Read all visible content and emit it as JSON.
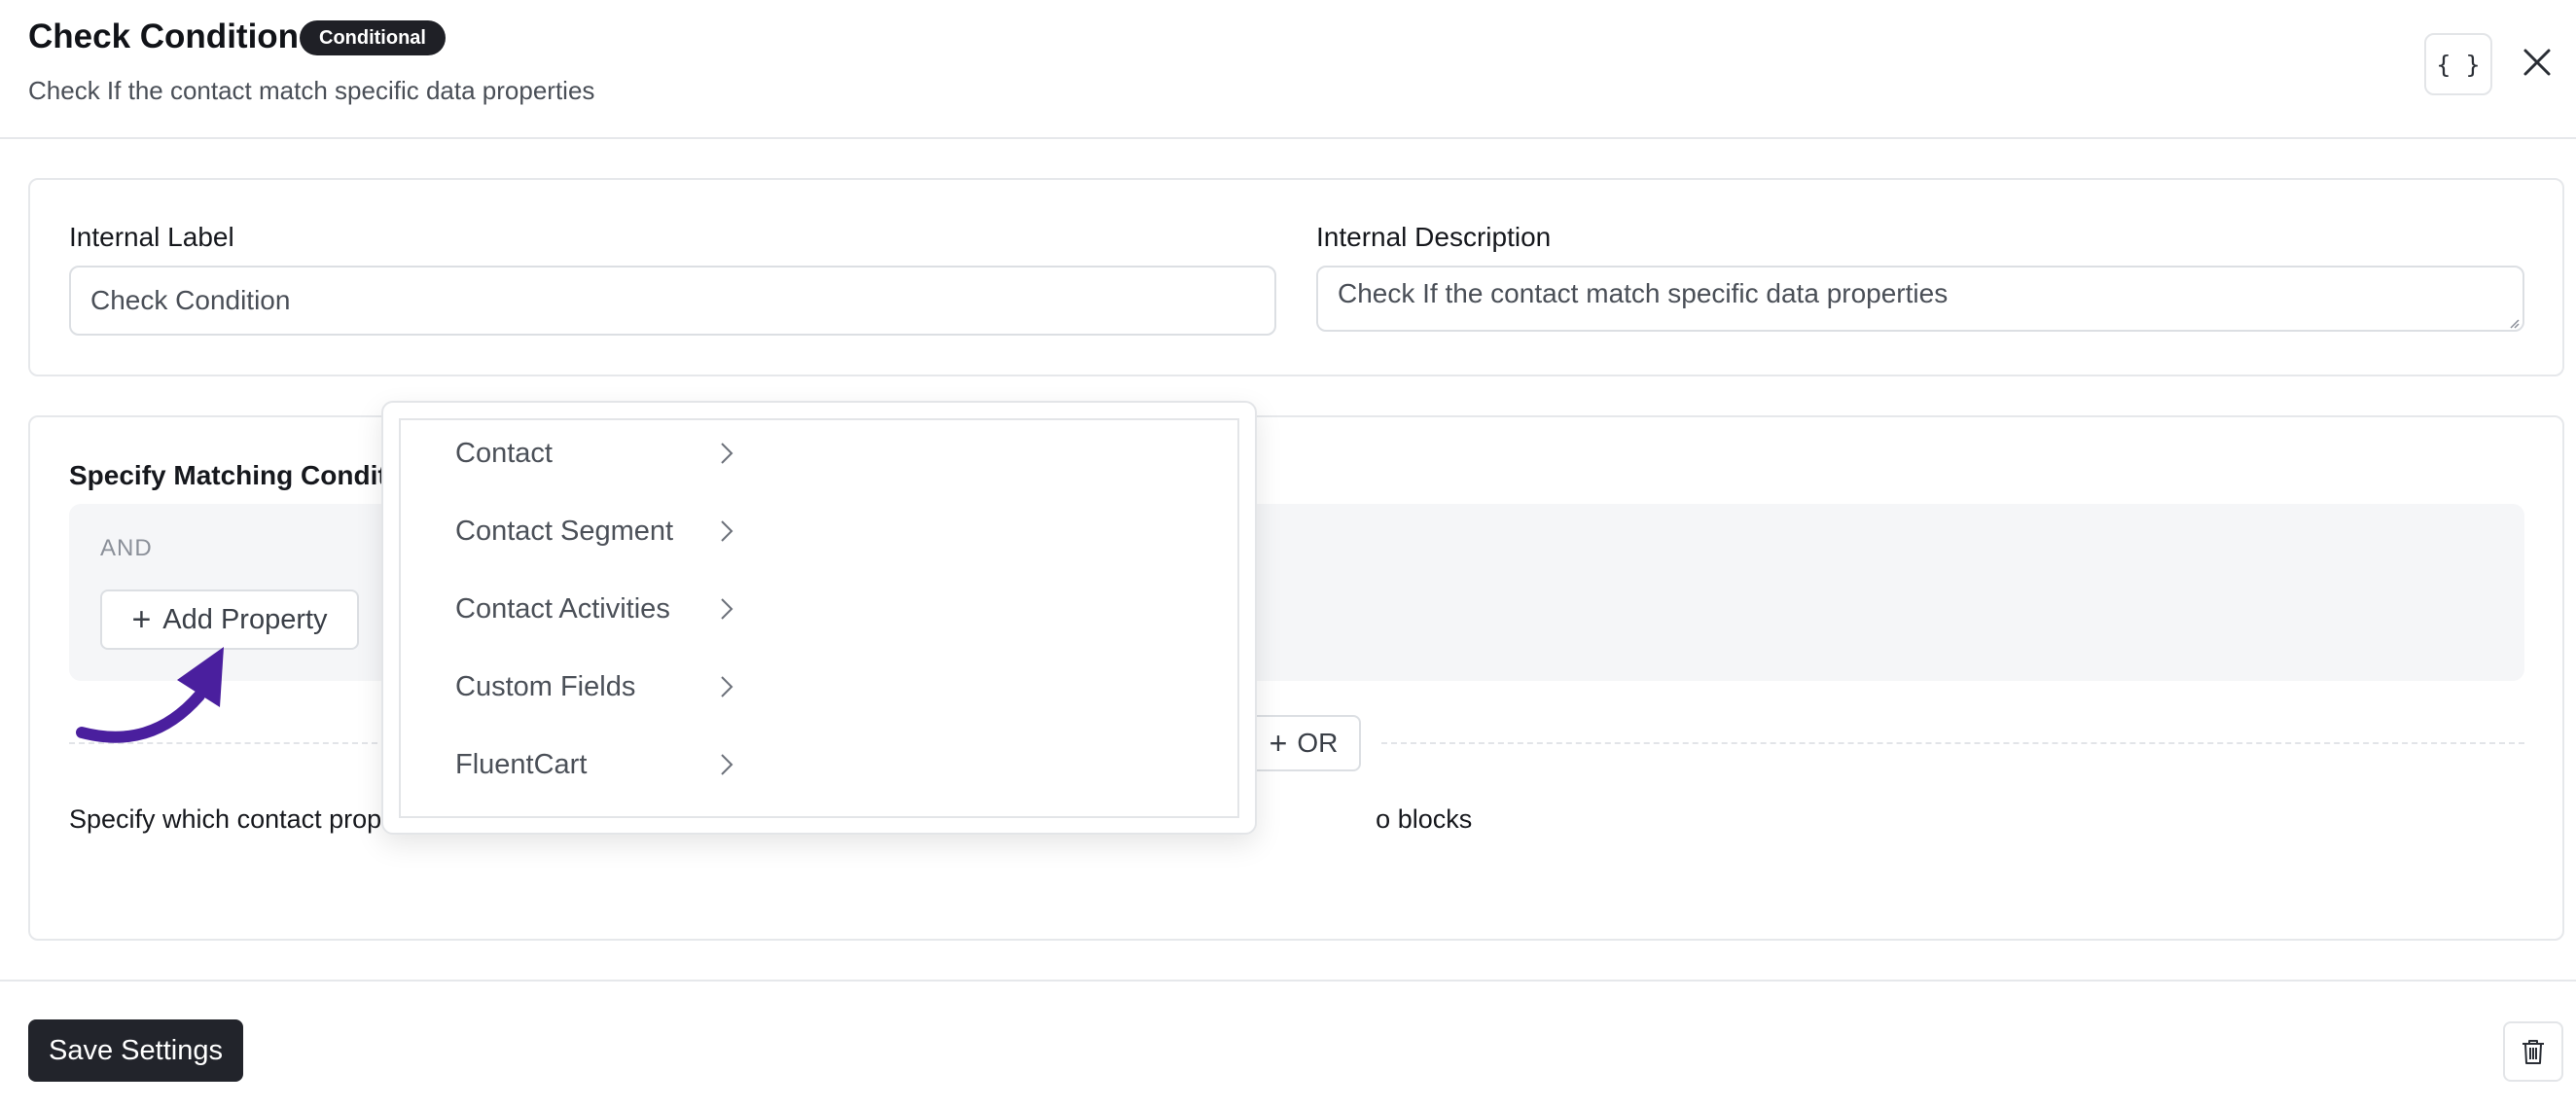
{
  "header": {
    "title": "Check Condition",
    "badge": "Conditional",
    "subtitle": "Check If the contact match specific data properties",
    "code_icon": "{ }"
  },
  "settings": {
    "internal_label": {
      "label": "Internal Label",
      "value": "Check Condition"
    },
    "internal_description": {
      "label": "Internal Description",
      "value": "Check If the contact match specific data properties"
    }
  },
  "conditions": {
    "heading": "Specify Matching Condit",
    "group_operator": "AND",
    "add_property_label": "Add Property",
    "or_label": "OR",
    "help_text_start": "Specify which contact prop",
    "help_text_end": "o blocks"
  },
  "dropdown": {
    "items": [
      {
        "label": "Contact"
      },
      {
        "label": "Contact Segment"
      },
      {
        "label": "Contact Activities"
      },
      {
        "label": "Custom Fields"
      },
      {
        "label": "FluentCart"
      }
    ]
  },
  "footer": {
    "save_label": "Save Settings"
  },
  "colors": {
    "primary_dark": "#22242b",
    "arrow_annotation": "#4a1f9e",
    "border": "#e3e5e8"
  }
}
